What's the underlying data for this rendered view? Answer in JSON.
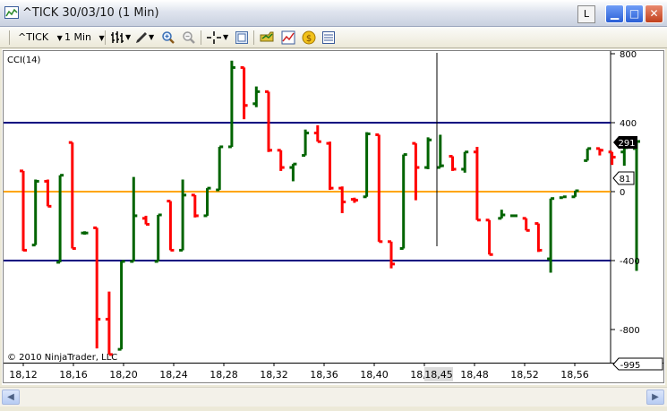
{
  "window": {
    "title": "^TICK  30/03/10 (1 Min)",
    "link_button": "L",
    "minimize_icon": "minimize-icon",
    "maximize_icon": "maximize-icon",
    "close_icon": "close-icon"
  },
  "toolbar": {
    "instrument": "^TICK",
    "interval": "1 Min",
    "icons": [
      "bar-type-icon",
      "drawing-tool-icon",
      "zoom-in-icon",
      "zoom-out-icon",
      "crosshair-icon",
      "properties-icon",
      "strategy-icon",
      "chart-icon",
      "market-analyzer-icon",
      "data-box-icon"
    ]
  },
  "colors": {
    "up_bar": "#006400",
    "down_bar": "#ff0000",
    "upper_band": "#000080",
    "lower_band": "#000080",
    "zero_line": "#ffa500",
    "last_value_label": "#000000"
  },
  "chart": {
    "indicator_label": "CCI(14)",
    "copyright": "© 2010 NinjaTrader, LLC",
    "crosshair_x_label": "18,45",
    "last_value": "291",
    "marker_value": "81",
    "min_value": "-995"
  },
  "chart_data": {
    "type": "bar",
    "indicator": "CCI(14)",
    "ylim": [
      -995,
      800
    ],
    "yticks": [
      800,
      400,
      0,
      -400,
      -800
    ],
    "ytick_labels": [
      "800",
      "400",
      "0",
      "-400",
      "-800"
    ],
    "xticks": [
      "18,12",
      "18,16",
      "18,20",
      "18,24",
      "18,28",
      "18,32",
      "18,36",
      "18,40",
      "18,44",
      "18,48",
      "18,52",
      "18,56"
    ],
    "reference_lines": [
      {
        "value": 400
      },
      {
        "value": 0
      },
      {
        "value": -400
      }
    ],
    "bars": [
      {
        "o": 120,
        "h": 120,
        "l": -345,
        "c": -340
      },
      {
        "o": -310,
        "h": 70,
        "l": -310,
        "c": 60
      },
      {
        "o": 60,
        "h": 70,
        "l": -85,
        "c": -85
      },
      {
        "o": -410,
        "h": 95,
        "l": -410,
        "c": 95
      },
      {
        "o": 285,
        "h": 285,
        "l": -330,
        "c": -330
      },
      {
        "o": -240,
        "h": -230,
        "l": -250,
        "c": -240
      },
      {
        "o": -210,
        "h": -210,
        "l": -910,
        "c": -740
      },
      {
        "o": -740,
        "h": -580,
        "l": -945,
        "c": -945
      },
      {
        "o": -915,
        "h": -405,
        "l": -915,
        "c": -405
      },
      {
        "o": -405,
        "h": 85,
        "l": -405,
        "c": -140
      },
      {
        "o": -155,
        "h": -140,
        "l": -190,
        "c": -190
      },
      {
        "o": -405,
        "h": -135,
        "l": -405,
        "c": -135
      },
      {
        "o": -55,
        "h": -55,
        "l": -340,
        "c": -340
      },
      {
        "o": -340,
        "h": 70,
        "l": -340,
        "c": -20
      },
      {
        "o": -20,
        "h": -20,
        "l": -150,
        "c": -140
      },
      {
        "o": -140,
        "h": 20,
        "l": -140,
        "c": 20
      },
      {
        "o": 10,
        "h": 260,
        "l": 10,
        "c": 260
      },
      {
        "o": 260,
        "h": 760,
        "l": 260,
        "c": 720
      },
      {
        "o": 720,
        "h": 720,
        "l": 420,
        "c": 500
      },
      {
        "o": 510,
        "h": 610,
        "l": 490,
        "c": 580
      },
      {
        "o": 580,
        "h": 580,
        "l": 230,
        "c": 240
      },
      {
        "o": 240,
        "h": 230,
        "l": 120,
        "c": 140
      },
      {
        "o": 140,
        "h": 160,
        "l": 60,
        "c": 160
      },
      {
        "o": 210,
        "h": 360,
        "l": 210,
        "c": 340
      },
      {
        "o": 340,
        "h": 385,
        "l": 290,
        "c": 290
      },
      {
        "o": 280,
        "h": 290,
        "l": 10,
        "c": 20
      },
      {
        "o": 20,
        "h": 30,
        "l": -125,
        "c": -60
      },
      {
        "o": -45,
        "h": -35,
        "l": -65,
        "c": -50
      },
      {
        "o": -30,
        "h": 345,
        "l": -30,
        "c": 335
      },
      {
        "o": 330,
        "h": 330,
        "l": -280,
        "c": -290
      },
      {
        "o": -290,
        "h": -290,
        "l": -445,
        "c": -420
      },
      {
        "o": -330,
        "h": 215,
        "l": -330,
        "c": 215
      },
      {
        "o": 280,
        "h": 280,
        "l": -50,
        "c": 140
      },
      {
        "o": 140,
        "h": 315,
        "l": 130,
        "c": 300
      },
      {
        "o": 140,
        "h": 330,
        "l": 140,
        "c": 150
      },
      {
        "o": 205,
        "h": 205,
        "l": 120,
        "c": 130
      },
      {
        "o": 130,
        "h": 230,
        "l": 110,
        "c": 230
      },
      {
        "o": 230,
        "h": 260,
        "l": -165,
        "c": -165
      },
      {
        "o": -165,
        "h": -170,
        "l": -365,
        "c": -365
      },
      {
        "o": -155,
        "h": -105,
        "l": -155,
        "c": -135
      },
      {
        "o": -140,
        "h": -135,
        "l": -140,
        "c": -140
      },
      {
        "o": -155,
        "h": -155,
        "l": -225,
        "c": -225
      },
      {
        "o": -185,
        "h": -185,
        "l": -350,
        "c": -340
      },
      {
        "o": -390,
        "h": -40,
        "l": -470,
        "c": -40
      },
      {
        "o": -35,
        "h": -35,
        "l": -30,
        "c": -30
      },
      {
        "o": -30,
        "h": 5,
        "l": -30,
        "c": 5
      },
      {
        "o": 180,
        "h": 250,
        "l": 180,
        "c": 250
      },
      {
        "o": 250,
        "h": 230,
        "l": 210,
        "c": 240
      },
      {
        "o": 230,
        "h": 230,
        "l": 155,
        "c": 200
      },
      {
        "o": 230,
        "h": 250,
        "l": 150,
        "c": 255
      },
      {
        "o": 250,
        "h": 290,
        "l": -460,
        "c": 291
      }
    ]
  }
}
